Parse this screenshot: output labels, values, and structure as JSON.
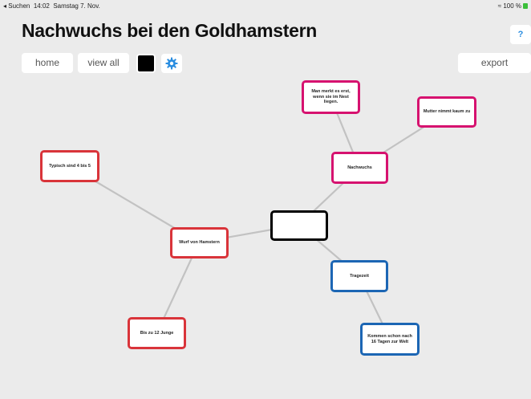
{
  "status_bar": {
    "back_label": "◂ Suchen",
    "time": "14:02",
    "date": "Samstag 7. Nov.",
    "wifi_icon": "wifi-icon",
    "battery": "100 %"
  },
  "header": {
    "title": "Nachwuchs bei den Goldhamstern",
    "help_label": "?"
  },
  "toolbar": {
    "home_label": "home",
    "view_all_label": "view all",
    "color_swatch": "#000000",
    "settings_icon": "gear-icon",
    "export_label": "export"
  },
  "colors": {
    "pink": "#d6126f",
    "red": "#d9343a",
    "blue": "#1c66b4",
    "black": "#000000",
    "connector": "#c2c2c2",
    "accent": "#2a8de0"
  },
  "mindmap": {
    "center": "",
    "nodes": {
      "nachwuchs": "Nachwuchs",
      "mutter": "Mutter nimmt kaum zu",
      "merkt": "Man merkt es erst, wenn sie im Nest liegen.",
      "wurf": "Wurf von Hamstern",
      "typisch": "Typisch sind 4 bis 5",
      "junge": "Bis zu 12 Junge",
      "tragezeit": "Tragezeit",
      "kommen": "Kommen schon nach 16 Tagen zur Welt"
    }
  }
}
